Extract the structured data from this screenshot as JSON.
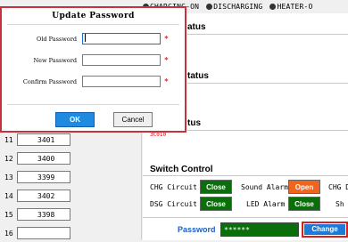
{
  "status_bar": {
    "items": [
      {
        "label": "CHARGING-ON"
      },
      {
        "label": "DISCHARGING"
      },
      {
        "label": "HEATER-O"
      }
    ]
  },
  "sections": {
    "status_1": "atus",
    "status_2": "tatus",
    "status_3": "tus",
    "small_red_text": "3C010"
  },
  "cells": [
    {
      "index": "11",
      "value": "3401"
    },
    {
      "index": "12",
      "value": "3400"
    },
    {
      "index": "13",
      "value": "3399"
    },
    {
      "index": "14",
      "value": "3402"
    },
    {
      "index": "15",
      "value": "3398"
    },
    {
      "index": "16",
      "value": ""
    }
  ],
  "switch_control": {
    "title": "Switch Control",
    "chg_circuit_label": "CHG Circuit",
    "chg_circuit_btn": "Close",
    "sound_alarm_label": "Sound Alarm",
    "sound_alarm_btn": "Open",
    "chg_d_label": "CHG D",
    "dsg_circuit_label": "DSG Circuit",
    "dsg_circuit_btn": "Close",
    "led_alarm_label": "LED Alarm",
    "led_alarm_btn": "Close",
    "sh_label": "Sh"
  },
  "password_bar": {
    "label": "Password",
    "value": "******",
    "change_label": "Change"
  },
  "dialog": {
    "title": "Update Password",
    "old_password_label": "Old Password",
    "new_password_label": "New Password",
    "confirm_password_label": "Confirm Password",
    "required_mark": "*",
    "ok_label": "OK",
    "cancel_label": "Cancel"
  },
  "colors": {
    "dialog_border": "#c8323c",
    "ok_button": "#1e8ae0",
    "close_button": "#0a6e0a",
    "open_button": "#f0641e",
    "change_button": "#1e7ad6"
  }
}
